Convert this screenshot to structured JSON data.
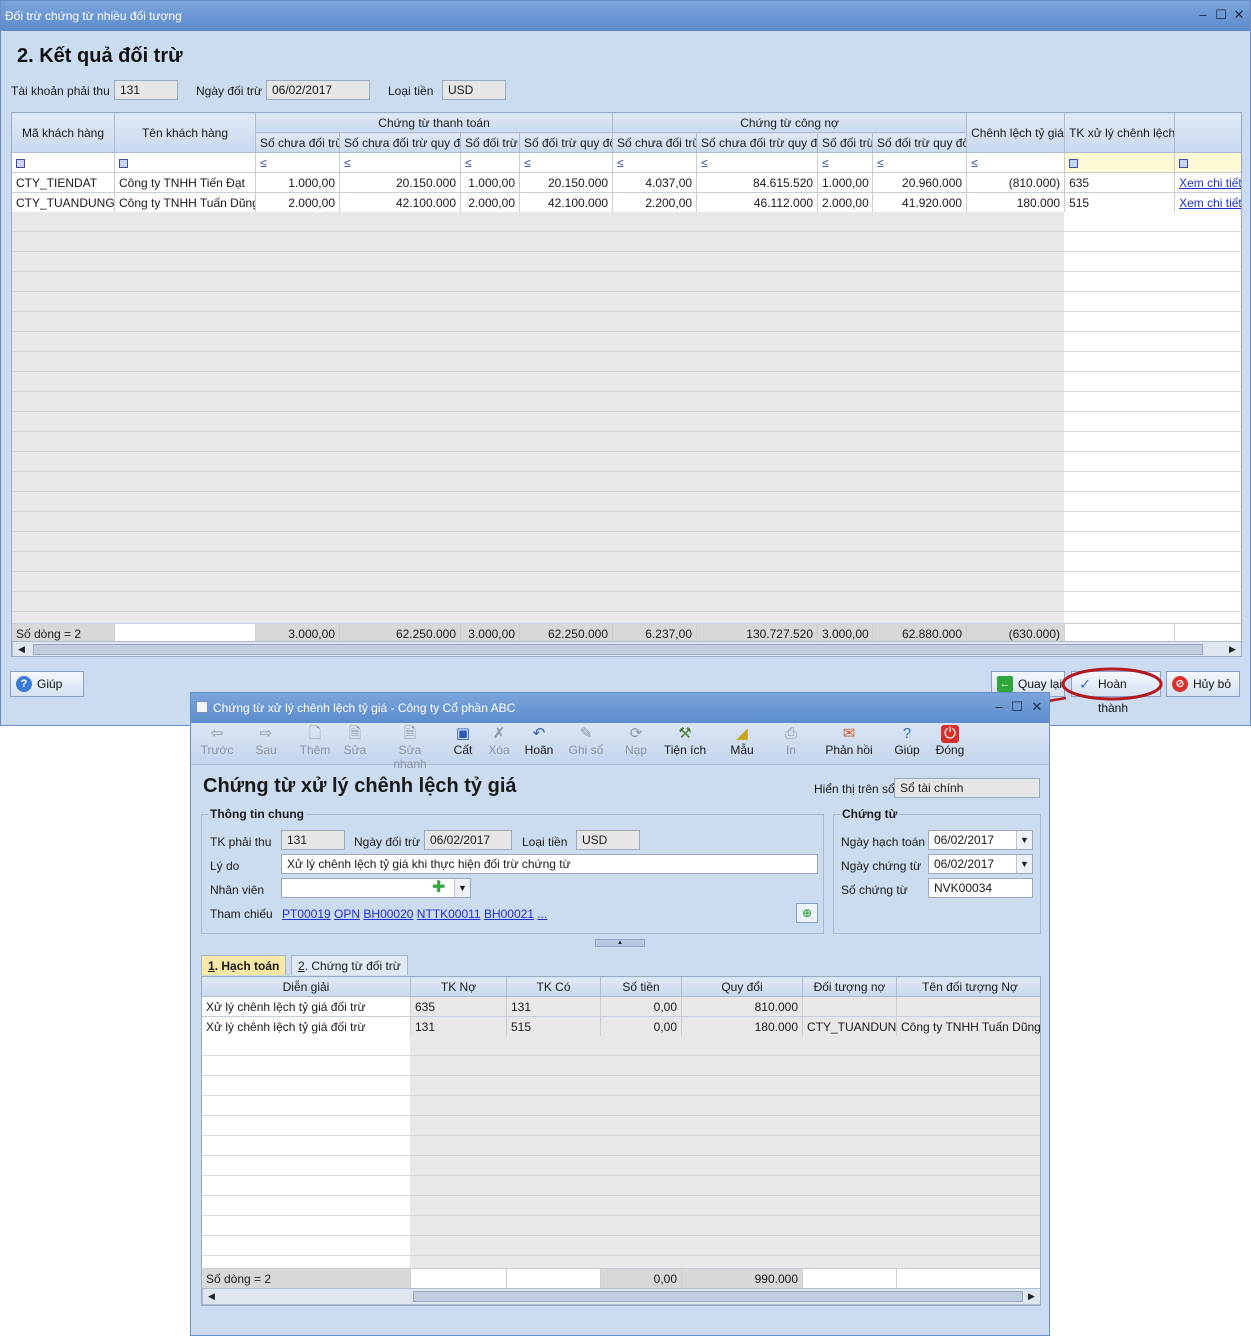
{
  "main_window": {
    "title": "Đối trừ chứng từ nhiều đối tượng",
    "section_title": "2. Kết quả đối trừ",
    "fields": {
      "account_label": "Tài khoản phải thu",
      "account_value": "131",
      "date_label": "Ngày đối trừ",
      "date_value": "06/02/2017",
      "currency_label": "Loại tiền",
      "currency_value": "USD"
    },
    "grid": {
      "headers": {
        "customer_code": "Mã khách hàng",
        "customer_name": "Tên khách hàng",
        "payment_group": "Chứng từ thanh toán",
        "debt_group": "Chứng từ công nợ",
        "exchange_diff": "Chênh lệch tỷ giá",
        "diff_account": "TK xử lý chênh lệch",
        "sub": [
          "Số chưa đối trừ",
          "Số chưa đối trừ quy đổi",
          "Số đối trừ",
          "Số đối trừ quy đổi",
          "Số chưa đối trừ",
          "Số chưa đối trừ quy đổi",
          "Số đối trừ",
          "Số đối trừ quy đổi"
        ]
      },
      "filter_symbol": "≤",
      "rows": [
        {
          "code": "CTY_TIENDAT",
          "name": "Công ty TNHH Tiến Đạt",
          "p1": "1.000,00",
          "p2": "20.150.000",
          "p3": "1.000,00",
          "p4": "20.150.000",
          "d1": "4.037,00",
          "d2": "84.615.520",
          "d3": "1.000,00",
          "d4": "20.960.000",
          "diff": "(810.000)",
          "acct": "635",
          "link": "Xem chi tiết"
        },
        {
          "code": "CTY_TUANDUNG",
          "name": "Công ty TNHH Tuấn Dũng",
          "p1": "2.000,00",
          "p2": "42.100.000",
          "p3": "2.000,00",
          "p4": "42.100.000",
          "d1": "2.200,00",
          "d2": "46.112.000",
          "d3": "2.000,00",
          "d4": "41.920.000",
          "diff": "180.000",
          "acct": "515",
          "link": "Xem chi tiết"
        }
      ],
      "summary": {
        "label": "Số dòng = 2",
        "p1": "3.000,00",
        "p2": "62.250.000",
        "p3": "3.000,00",
        "p4": "62.250.000",
        "d1": "6.237,00",
        "d2": "130.727.520",
        "d3": "3.000,00",
        "d4": "62.880.000",
        "diff": "(630.000)"
      }
    },
    "buttons": {
      "help": "Giúp",
      "back": "Quay lại",
      "finish": "Hoàn thành",
      "cancel": "Hủy bỏ"
    }
  },
  "voucher_window": {
    "title": "Chứng từ xử lý chênh lệch tỷ giá - Công ty Cổ phần ABC",
    "toolbar": [
      "Trước",
      "Sau",
      "Thêm",
      "Sửa",
      "Sửa nhanh",
      "Cất",
      "Xóa",
      "Hoãn",
      "Ghi sổ",
      "Nạp",
      "Tiện ích",
      "Mẫu",
      "In",
      "Phản hồi",
      "Giúp",
      "Đóng"
    ],
    "heading": "Chứng từ xử lý chênh lệch tỷ giá",
    "display_label": "Hiển thị trên sổ",
    "display_value": "Sổ tài chính",
    "general": {
      "title": "Thông tin chung",
      "account_label": "TK phải thu",
      "account_value": "131",
      "date_label": "Ngày đối trừ",
      "date_value": "06/02/2017",
      "currency_label": "Loại tiền",
      "currency_value": "USD",
      "reason_label": "Lý do",
      "reason_value": "Xử lý chênh lệch tỷ giá khi thực hiện đối trừ chứng từ",
      "employee_label": "Nhân viên",
      "ref_label": "Tham chiếu",
      "refs": [
        "PT00019",
        "OPN",
        "BH00020",
        "NTTK00011",
        "BH00021",
        "..."
      ]
    },
    "voucher": {
      "title": "Chứng từ",
      "posting_date_label": "Ngày hạch toán",
      "posting_date_value": "06/02/2017",
      "voucher_date_label": "Ngày chứng từ",
      "voucher_date_value": "06/02/2017",
      "voucher_no_label": "Số chứng từ",
      "voucher_no_value": "NVK00034"
    },
    "tabs": {
      "tab1_key": "1",
      "tab1": ". Hạch toán",
      "tab2_key": "2",
      "tab2": ". Chứng từ đối trừ"
    },
    "grid": {
      "headers": [
        "Diễn giải",
        "TK Nợ",
        "TK Có",
        "Số tiền",
        "Quy đổi",
        "Đối tượng nợ",
        "Tên đối tượng Nợ"
      ],
      "rows": [
        {
          "desc": "Xử lý chênh lệch tỷ giá đối trừ",
          "debit": "635",
          "credit": "131",
          "amount": "0,00",
          "converted": "810.000",
          "obj": "",
          "obj_name": ""
        },
        {
          "desc": "Xử lý chênh lệch tỷ giá đối trừ",
          "debit": "131",
          "credit": "515",
          "amount": "0,00",
          "converted": "180.000",
          "obj": "CTY_TUANDUN",
          "obj_name": "Công ty TNHH Tuấn Dũng"
        }
      ],
      "summary": {
        "label": "Số dòng = 2",
        "amount": "0,00",
        "converted": "990.000"
      }
    }
  }
}
